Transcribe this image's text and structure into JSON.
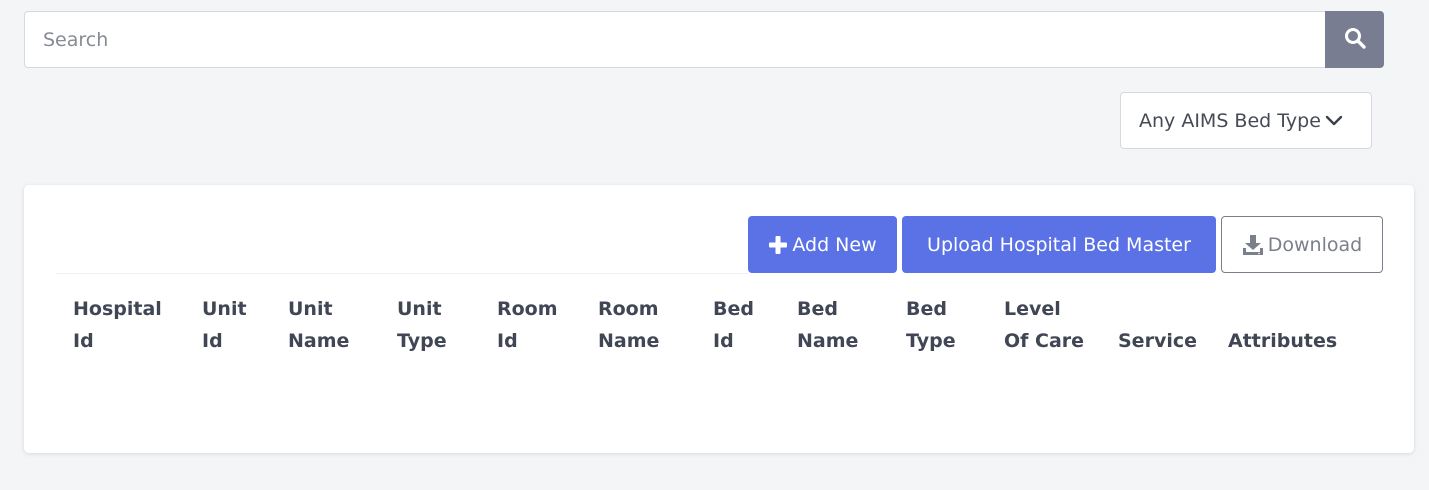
{
  "search": {
    "placeholder": "Search",
    "button_icon": "search-icon"
  },
  "filter": {
    "bed_type_label": "Any AIMS Bed Type",
    "icon": "chevron-down-icon"
  },
  "toolbar": {
    "add_new_label": "Add New",
    "add_new_icon": "plus-icon",
    "upload_label": "Upload Hospital Bed Master",
    "download_label": "Download",
    "download_icon": "download-icon"
  },
  "table": {
    "columns": [
      {
        "line1": "Hospital",
        "line2": "Id"
      },
      {
        "line1": "Unit",
        "line2": "Id"
      },
      {
        "line1": "Unit",
        "line2": "Name"
      },
      {
        "line1": "Unit",
        "line2": "Type"
      },
      {
        "line1": "Room",
        "line2": "Id"
      },
      {
        "line1": "Room",
        "line2": "Name"
      },
      {
        "line1": "Bed",
        "line2": "Id"
      },
      {
        "line1": "Bed",
        "line2": "Name"
      },
      {
        "line1": "Bed",
        "line2": "Type"
      },
      {
        "line1": "Level",
        "line2": "Of Care"
      },
      {
        "line1": "",
        "line2": "Service"
      },
      {
        "line1": "",
        "line2": "Attributes"
      }
    ],
    "rows": []
  },
  "colors": {
    "primary": "#5a72e6",
    "search_button": "#787d91",
    "background": "#f4f5f7"
  }
}
